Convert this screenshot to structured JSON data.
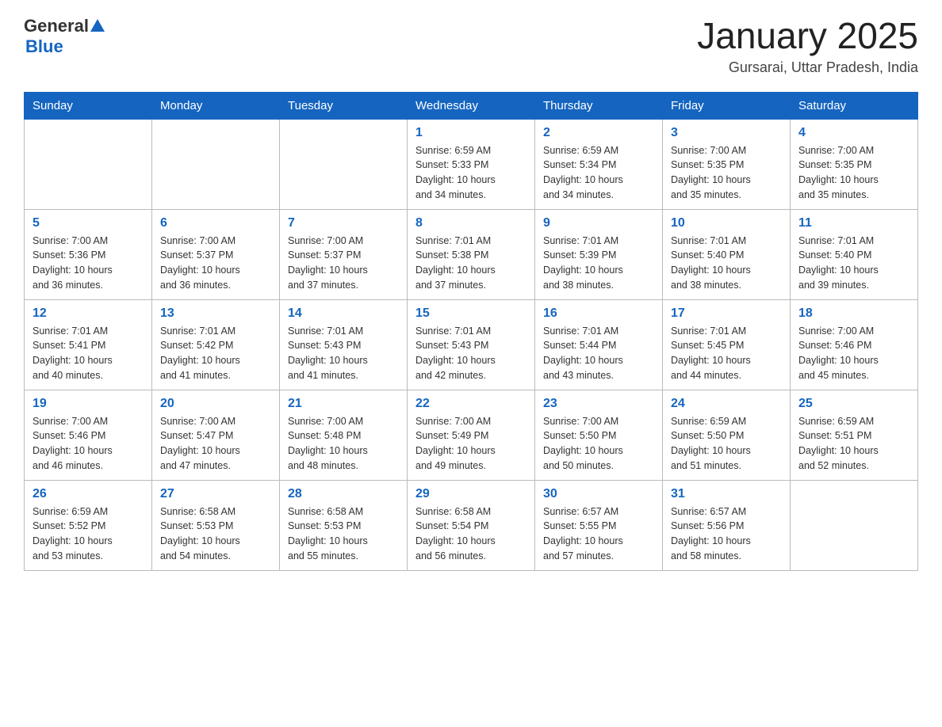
{
  "header": {
    "logo_general": "General",
    "logo_blue": "Blue",
    "month_title": "January 2025",
    "location": "Gursarai, Uttar Pradesh, India"
  },
  "days_of_week": [
    "Sunday",
    "Monday",
    "Tuesday",
    "Wednesday",
    "Thursday",
    "Friday",
    "Saturday"
  ],
  "weeks": [
    [
      {
        "day": "",
        "info": ""
      },
      {
        "day": "",
        "info": ""
      },
      {
        "day": "",
        "info": ""
      },
      {
        "day": "1",
        "info": "Sunrise: 6:59 AM\nSunset: 5:33 PM\nDaylight: 10 hours\nand 34 minutes."
      },
      {
        "day": "2",
        "info": "Sunrise: 6:59 AM\nSunset: 5:34 PM\nDaylight: 10 hours\nand 34 minutes."
      },
      {
        "day": "3",
        "info": "Sunrise: 7:00 AM\nSunset: 5:35 PM\nDaylight: 10 hours\nand 35 minutes."
      },
      {
        "day": "4",
        "info": "Sunrise: 7:00 AM\nSunset: 5:35 PM\nDaylight: 10 hours\nand 35 minutes."
      }
    ],
    [
      {
        "day": "5",
        "info": "Sunrise: 7:00 AM\nSunset: 5:36 PM\nDaylight: 10 hours\nand 36 minutes."
      },
      {
        "day": "6",
        "info": "Sunrise: 7:00 AM\nSunset: 5:37 PM\nDaylight: 10 hours\nand 36 minutes."
      },
      {
        "day": "7",
        "info": "Sunrise: 7:00 AM\nSunset: 5:37 PM\nDaylight: 10 hours\nand 37 minutes."
      },
      {
        "day": "8",
        "info": "Sunrise: 7:01 AM\nSunset: 5:38 PM\nDaylight: 10 hours\nand 37 minutes."
      },
      {
        "day": "9",
        "info": "Sunrise: 7:01 AM\nSunset: 5:39 PM\nDaylight: 10 hours\nand 38 minutes."
      },
      {
        "day": "10",
        "info": "Sunrise: 7:01 AM\nSunset: 5:40 PM\nDaylight: 10 hours\nand 38 minutes."
      },
      {
        "day": "11",
        "info": "Sunrise: 7:01 AM\nSunset: 5:40 PM\nDaylight: 10 hours\nand 39 minutes."
      }
    ],
    [
      {
        "day": "12",
        "info": "Sunrise: 7:01 AM\nSunset: 5:41 PM\nDaylight: 10 hours\nand 40 minutes."
      },
      {
        "day": "13",
        "info": "Sunrise: 7:01 AM\nSunset: 5:42 PM\nDaylight: 10 hours\nand 41 minutes."
      },
      {
        "day": "14",
        "info": "Sunrise: 7:01 AM\nSunset: 5:43 PM\nDaylight: 10 hours\nand 41 minutes."
      },
      {
        "day": "15",
        "info": "Sunrise: 7:01 AM\nSunset: 5:43 PM\nDaylight: 10 hours\nand 42 minutes."
      },
      {
        "day": "16",
        "info": "Sunrise: 7:01 AM\nSunset: 5:44 PM\nDaylight: 10 hours\nand 43 minutes."
      },
      {
        "day": "17",
        "info": "Sunrise: 7:01 AM\nSunset: 5:45 PM\nDaylight: 10 hours\nand 44 minutes."
      },
      {
        "day": "18",
        "info": "Sunrise: 7:00 AM\nSunset: 5:46 PM\nDaylight: 10 hours\nand 45 minutes."
      }
    ],
    [
      {
        "day": "19",
        "info": "Sunrise: 7:00 AM\nSunset: 5:46 PM\nDaylight: 10 hours\nand 46 minutes."
      },
      {
        "day": "20",
        "info": "Sunrise: 7:00 AM\nSunset: 5:47 PM\nDaylight: 10 hours\nand 47 minutes."
      },
      {
        "day": "21",
        "info": "Sunrise: 7:00 AM\nSunset: 5:48 PM\nDaylight: 10 hours\nand 48 minutes."
      },
      {
        "day": "22",
        "info": "Sunrise: 7:00 AM\nSunset: 5:49 PM\nDaylight: 10 hours\nand 49 minutes."
      },
      {
        "day": "23",
        "info": "Sunrise: 7:00 AM\nSunset: 5:50 PM\nDaylight: 10 hours\nand 50 minutes."
      },
      {
        "day": "24",
        "info": "Sunrise: 6:59 AM\nSunset: 5:50 PM\nDaylight: 10 hours\nand 51 minutes."
      },
      {
        "day": "25",
        "info": "Sunrise: 6:59 AM\nSunset: 5:51 PM\nDaylight: 10 hours\nand 52 minutes."
      }
    ],
    [
      {
        "day": "26",
        "info": "Sunrise: 6:59 AM\nSunset: 5:52 PM\nDaylight: 10 hours\nand 53 minutes."
      },
      {
        "day": "27",
        "info": "Sunrise: 6:58 AM\nSunset: 5:53 PM\nDaylight: 10 hours\nand 54 minutes."
      },
      {
        "day": "28",
        "info": "Sunrise: 6:58 AM\nSunset: 5:53 PM\nDaylight: 10 hours\nand 55 minutes."
      },
      {
        "day": "29",
        "info": "Sunrise: 6:58 AM\nSunset: 5:54 PM\nDaylight: 10 hours\nand 56 minutes."
      },
      {
        "day": "30",
        "info": "Sunrise: 6:57 AM\nSunset: 5:55 PM\nDaylight: 10 hours\nand 57 minutes."
      },
      {
        "day": "31",
        "info": "Sunrise: 6:57 AM\nSunset: 5:56 PM\nDaylight: 10 hours\nand 58 minutes."
      },
      {
        "day": "",
        "info": ""
      }
    ]
  ]
}
